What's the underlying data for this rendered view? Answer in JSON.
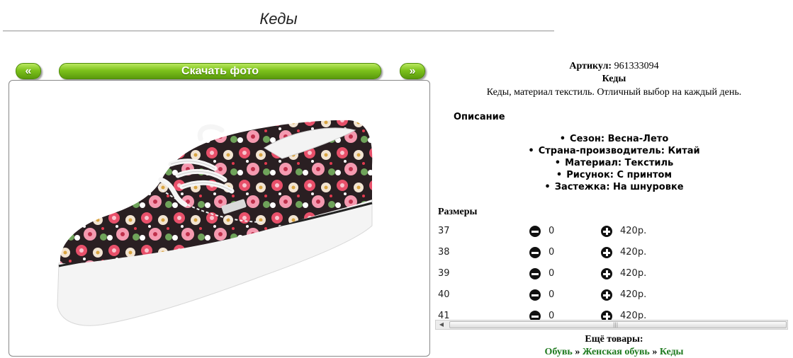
{
  "page": {
    "title": "Кеды"
  },
  "gallery": {
    "prev_label": "«",
    "download_label": "Скачать фото",
    "next_label": "»"
  },
  "product": {
    "sku_label": "Артикул:",
    "sku_value": "961333094",
    "name": "Кеды",
    "short_description": "Кеды, материал текстиль. Отличный выбор на каждый день.",
    "description_heading": "Описание",
    "attributes": [
      "Сезон: Весна-Лето",
      "Страна-производитель: Китай",
      "Материал: Текстиль",
      "Рисунок: С принтом",
      "Застежка: На шнуровке"
    ]
  },
  "sizes": {
    "heading": "Размеры",
    "rows": [
      {
        "size": "37",
        "qty": "0",
        "price": "420р."
      },
      {
        "size": "38",
        "qty": "0",
        "price": "420р."
      },
      {
        "size": "39",
        "qty": "0",
        "price": "420р."
      },
      {
        "size": "40",
        "qty": "0",
        "price": "420р."
      },
      {
        "size": "41",
        "qty": "0",
        "price": "420р."
      }
    ]
  },
  "more": {
    "heading": "Ещё товары:",
    "breadcrumb": [
      "Обувь",
      "Женская обувь",
      "Кеды"
    ],
    "separator": "»"
  },
  "colors": {
    "link_green": "#1f7a1f",
    "button_green": "#7dc21c"
  }
}
